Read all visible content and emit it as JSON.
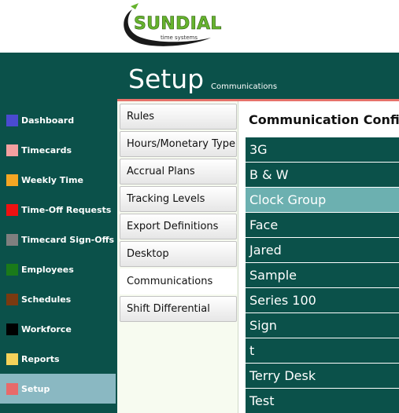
{
  "logo": {
    "brand": "SUNDIAL",
    "tagline": "time systems"
  },
  "page": {
    "title": "Setup",
    "subtitle": "Communications"
  },
  "sidebar": {
    "items": [
      {
        "label": "Dashboard",
        "color": "#4a4ad0"
      },
      {
        "label": "Timecards",
        "color": "#f4a0a0"
      },
      {
        "label": "Weekly Time",
        "color": "#f5a623"
      },
      {
        "label": "Time-Off Requests",
        "color": "#ee1111"
      },
      {
        "label": "Timecard Sign-Offs",
        "color": "#7f7f7f"
      },
      {
        "label": "Employees",
        "color": "#1a7a1a"
      },
      {
        "label": "Schedules",
        "color": "#7a3a10"
      },
      {
        "label": "Workforce",
        "color": "#000000"
      },
      {
        "label": "Reports",
        "color": "#f5d25a"
      },
      {
        "label": "Setup",
        "color": "#e86a6a",
        "active": true
      }
    ]
  },
  "tabs": [
    {
      "label": "Rules"
    },
    {
      "label": "Hours/Monetary Type"
    },
    {
      "label": "Accrual Plans"
    },
    {
      "label": "Tracking Levels"
    },
    {
      "label": "Export Definitions"
    },
    {
      "label": "Desktop"
    },
    {
      "label": "Communications",
      "active": true
    },
    {
      "label": "Shift Differential"
    }
  ],
  "content": {
    "title": "Communication Confi",
    "rows": [
      {
        "label": "3G"
      },
      {
        "label": "B & W"
      },
      {
        "label": "Clock Group",
        "selected": true
      },
      {
        "label": "Face"
      },
      {
        "label": "Jared"
      },
      {
        "label": "Sample"
      },
      {
        "label": "Series 100"
      },
      {
        "label": "Sign"
      },
      {
        "label": "t"
      },
      {
        "label": "Terry Desk"
      },
      {
        "label": "Test"
      }
    ]
  }
}
